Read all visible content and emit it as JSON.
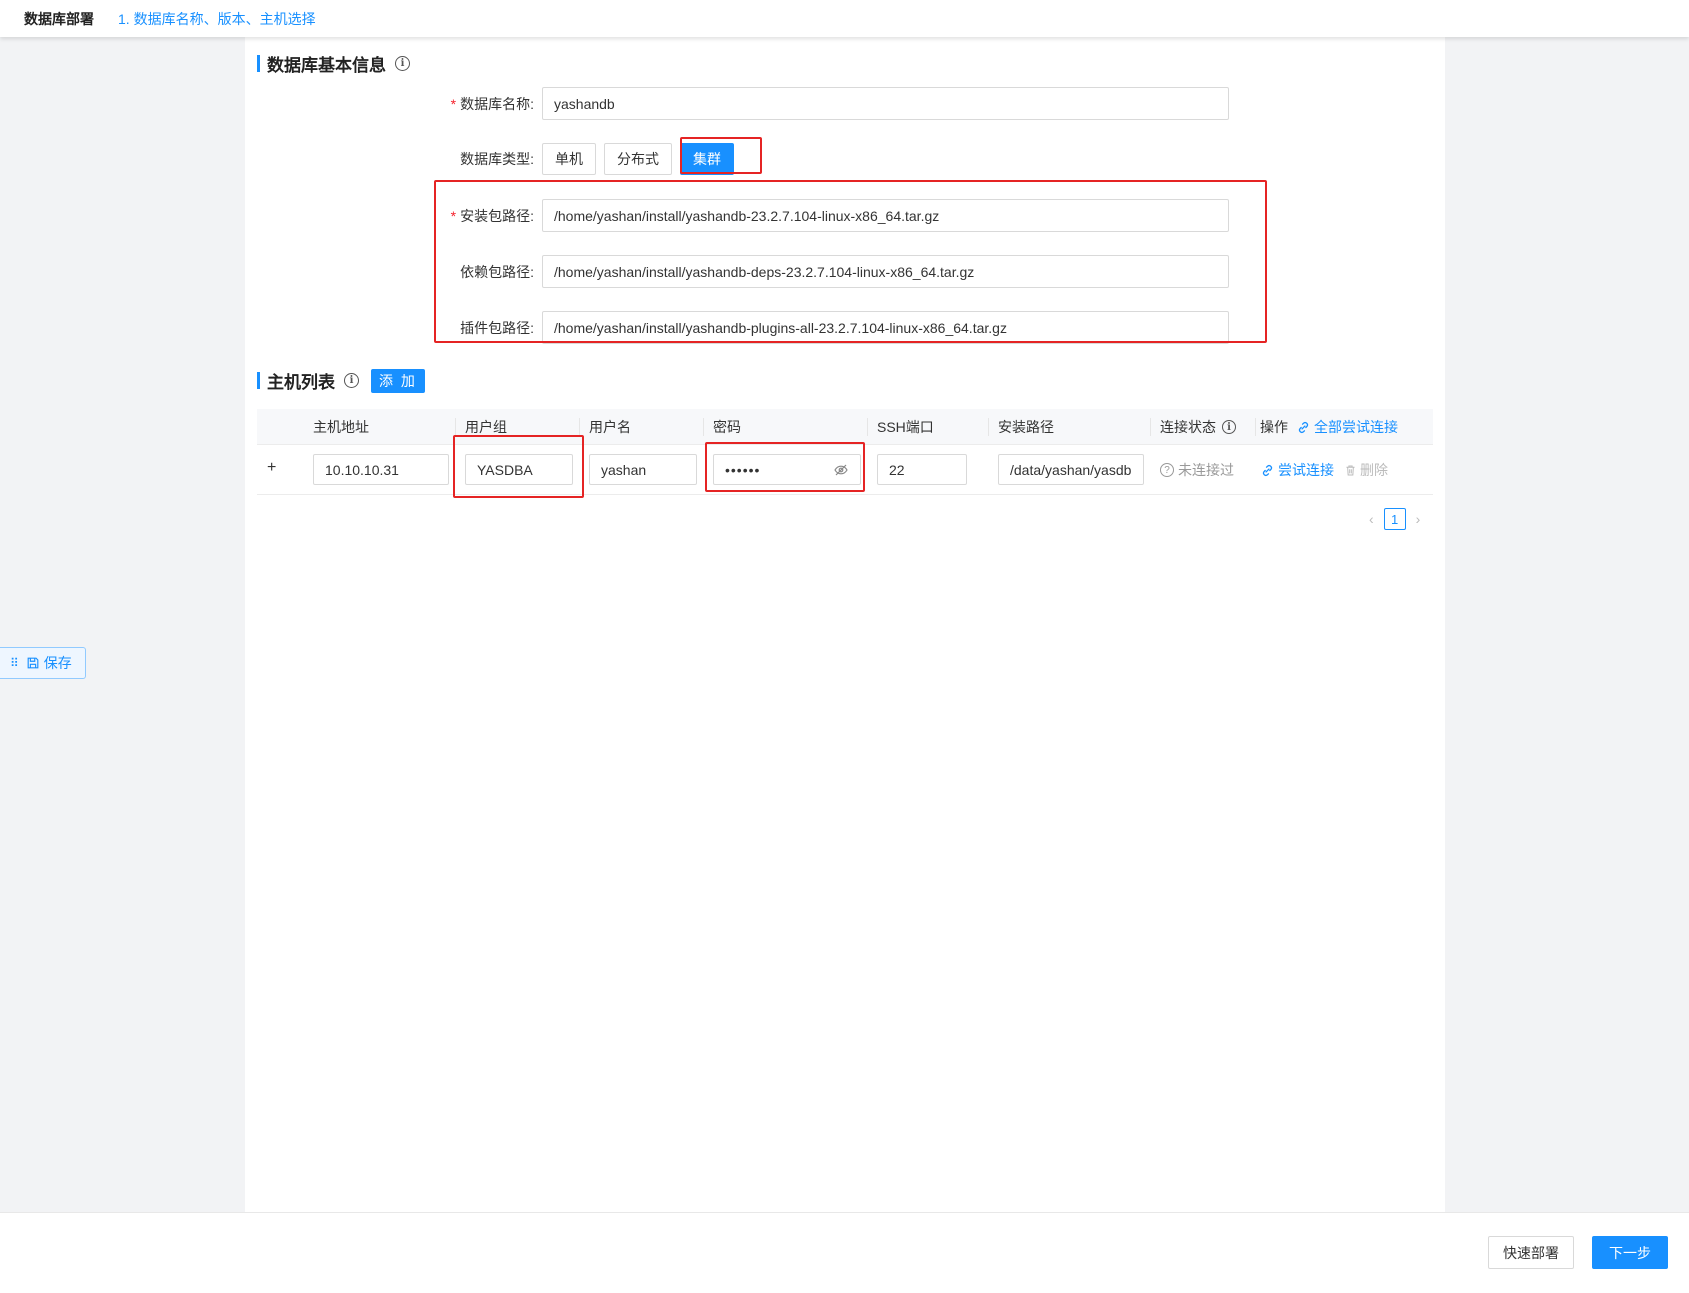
{
  "header": {
    "app_title": "数据库部署",
    "step_crumb": "1. 数据库名称、版本、主机选择"
  },
  "basic_info": {
    "title": "数据库基本信息",
    "info_icon": "info-icon",
    "db_name_label": "数据库名称:",
    "db_name_value": "yashandb",
    "db_type_label": "数据库类型:",
    "db_types": [
      "单机",
      "分布式",
      "集群"
    ],
    "db_type_selected": "集群",
    "install_pkg_label": "安装包路径:",
    "install_pkg_value": "/home/yashan/install/yashandb-23.2.7.104-linux-x86_64.tar.gz",
    "deps_pkg_label": "依赖包路径:",
    "deps_pkg_value": "/home/yashan/install/yashandb-deps-23.2.7.104-linux-x86_64.tar.gz",
    "plugin_pkg_label": "插件包路径:",
    "plugin_pkg_value": "/home/yashan/install/yashandb-plugins-all-23.2.7.104-linux-x86_64.tar.gz"
  },
  "host_list": {
    "title": "主机列表",
    "add_label": "添 加",
    "columns": {
      "host": "主机地址",
      "group": "用户组",
      "user": "用户名",
      "password": "密码",
      "ssh_port": "SSH端口",
      "install_path": "安装路径",
      "conn_status": "连接状态",
      "actions": "操作",
      "try_all": "全部尝试连接"
    },
    "rows": [
      {
        "expand": "+",
        "host": "10.10.10.31",
        "group": "YASDBA",
        "user": "yashan",
        "password_mask": "••••••",
        "ssh_port": "22",
        "install_path": "/data/yashan/yasdb",
        "status": "未连接过",
        "try_connect": "尝试连接",
        "delete": "删除"
      }
    ],
    "page": "1"
  },
  "floating": {
    "save_label": "保存"
  },
  "footer": {
    "quick_deploy": "快速部署",
    "next": "下一步"
  }
}
